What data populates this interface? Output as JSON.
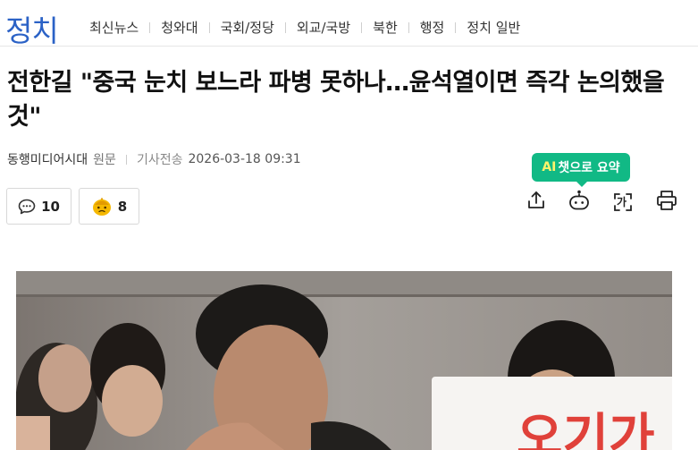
{
  "header": {
    "section_title": "정치",
    "menu": [
      "최신뉴스",
      "청와대",
      "국회/정당",
      "외교/국방",
      "북한",
      "행정",
      "정치 일반"
    ]
  },
  "article": {
    "headline": "전한길 \"중국 눈치 보느라 파병 못하나…윤석열이면 즉각 논의했을 것\"",
    "press": "동행미디어시대",
    "origin_label": "원문",
    "sent_label": "기사전송",
    "datetime": "2026-03-18 09:31"
  },
  "reactions": {
    "comment_count": "10",
    "emotion_count": "8"
  },
  "tools": {
    "ai_summary_prefix": "AI",
    "ai_summary_label": "챗으로 요약",
    "icons": [
      "share-icon",
      "ai-chat-icon",
      "font-size-icon",
      "print-icon"
    ],
    "font_glyph": "가"
  },
  "photo": {
    "sign_text": "오기가"
  },
  "colors": {
    "section_title": "#2b62c6",
    "ai_badge": "#11b985",
    "ai_badge_text": "#fff36b",
    "sign_text": "#e0413a"
  }
}
